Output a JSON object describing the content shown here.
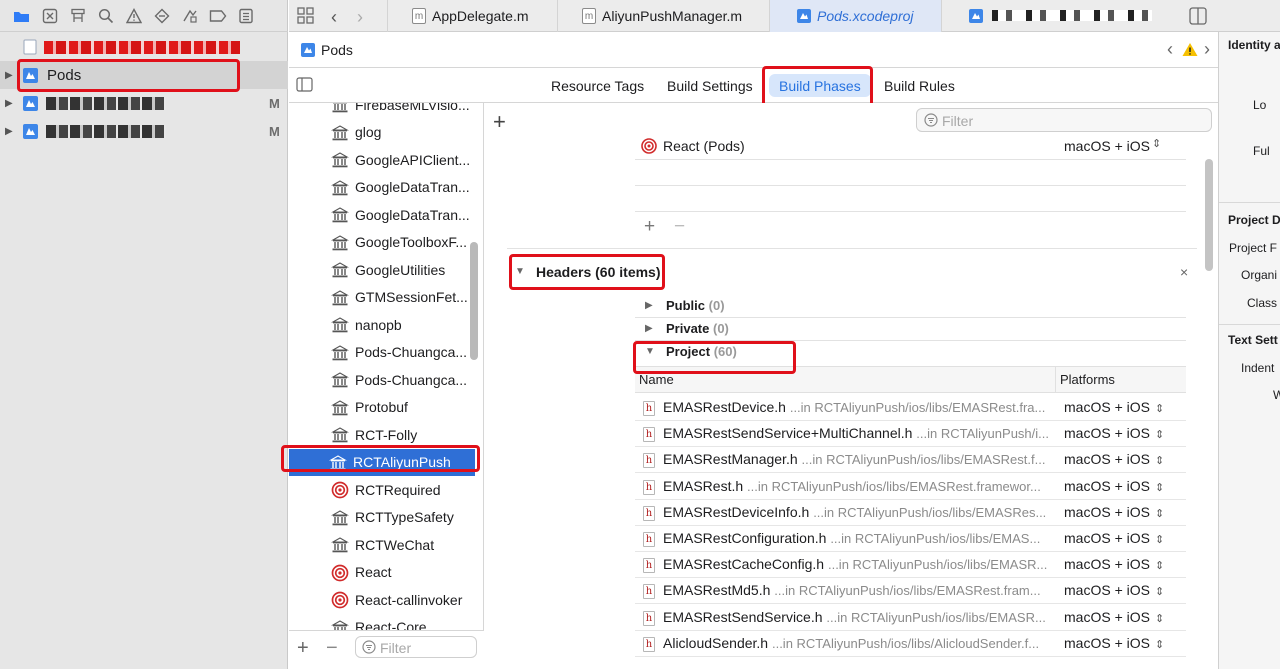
{
  "navigator": {
    "toolbar_icons": [
      "folder-icon",
      "source-control-icon",
      "hierarchy-icon",
      "search-icon",
      "warning-icon",
      "test-diamond-icon",
      "debug-icon",
      "breakpoint-icon",
      "report-icon"
    ],
    "rows": [
      {
        "label": "Pods",
        "mark": ""
      },
      {
        "label": "",
        "mark": "M"
      },
      {
        "label": "",
        "mark": "M"
      }
    ]
  },
  "tabs": [
    {
      "label": "AppDelegate.m"
    },
    {
      "label": "AliyunPushManager.m"
    },
    {
      "label": "Pods.xcodeproj"
    }
  ],
  "pathbar": {
    "project": "Pods"
  },
  "modes": {
    "resource_tags": "Resource Tags",
    "build_settings": "Build Settings",
    "build_phases": "Build Phases",
    "build_rules": "Build Rules"
  },
  "filter": {
    "placeholder": "Filter",
    "bottom_placeholder": "Filter"
  },
  "targets": [
    {
      "label": "FirebaseMLVisio...",
      "kind": "library"
    },
    {
      "label": "glog",
      "kind": "library"
    },
    {
      "label": "GoogleAPIClient...",
      "kind": "library"
    },
    {
      "label": "GoogleDataTran...",
      "kind": "library"
    },
    {
      "label": "GoogleDataTran...",
      "kind": "library"
    },
    {
      "label": "GoogleToolboxF...",
      "kind": "library"
    },
    {
      "label": "GoogleUtilities",
      "kind": "library"
    },
    {
      "label": "GTMSessionFet...",
      "kind": "library"
    },
    {
      "label": "nanopb",
      "kind": "library"
    },
    {
      "label": "Pods-Chuangca...",
      "kind": "library"
    },
    {
      "label": "Pods-Chuangca...",
      "kind": "library"
    },
    {
      "label": "Protobuf",
      "kind": "library"
    },
    {
      "label": "RCT-Folly",
      "kind": "library"
    },
    {
      "label": "RCTAliyunPush",
      "kind": "library",
      "selected": true
    },
    {
      "label": "RCTRequired",
      "kind": "target"
    },
    {
      "label": "RCTTypeSafety",
      "kind": "library"
    },
    {
      "label": "RCTWeChat",
      "kind": "library"
    },
    {
      "label": "React",
      "kind": "target"
    },
    {
      "label": "React-callinvoker",
      "kind": "target"
    },
    {
      "label": "React-Core",
      "kind": "library"
    }
  ],
  "dependency": {
    "name": "React (Pods)",
    "platforms": "macOS + iOS"
  },
  "headers": {
    "title": "Headers (60 items)",
    "public": {
      "label": "Public",
      "count": "(0)"
    },
    "private": {
      "label": "Private",
      "count": "(0)"
    },
    "project": {
      "label": "Project",
      "count": "(60)"
    },
    "col_name": "Name",
    "col_platforms": "Platforms",
    "rows": [
      {
        "name": "EMASRestDevice.h",
        "path": "...in RCTAliyunPush/ios/libs/EMASRest.fra...",
        "platforms": "macOS + iOS"
      },
      {
        "name": "EMASRestSendService+MultiChannel.h",
        "path": "...in RCTAliyunPush/i...",
        "platforms": "macOS + iOS"
      },
      {
        "name": "EMASRestManager.h",
        "path": "...in RCTAliyunPush/ios/libs/EMASRest.f...",
        "platforms": "macOS + iOS"
      },
      {
        "name": "EMASRest.h",
        "path": "...in RCTAliyunPush/ios/libs/EMASRest.framewor...",
        "platforms": "macOS + iOS"
      },
      {
        "name": "EMASRestDeviceInfo.h",
        "path": "...in RCTAliyunPush/ios/libs/EMASRes...",
        "platforms": "macOS + iOS"
      },
      {
        "name": "EMASRestConfiguration.h",
        "path": "...in RCTAliyunPush/ios/libs/EMAS...",
        "platforms": "macOS + iOS"
      },
      {
        "name": "EMASRestCacheConfig.h",
        "path": "...in RCTAliyunPush/ios/libs/EMASR...",
        "platforms": "macOS + iOS"
      },
      {
        "name": "EMASRestMd5.h",
        "path": "...in RCTAliyunPush/ios/libs/EMASRest.fram...",
        "platforms": "macOS + iOS"
      },
      {
        "name": "EMASRestSendService.h",
        "path": "...in RCTAliyunPush/ios/libs/EMASR...",
        "platforms": "macOS + iOS"
      },
      {
        "name": "AlicloudSender.h",
        "path": "...in RCTAliyunPush/ios/libs/AlicloudSender.f...",
        "platforms": "macOS + iOS"
      }
    ]
  },
  "inspector": {
    "identity": "Identity a",
    "lo": "Lo",
    "ful": "Ful",
    "project_doc": "Project D",
    "project_f": "Project F",
    "organi": "Organi",
    "class": "Class",
    "text_settings": "Text Sett",
    "indent": "Indent",
    "w": "W"
  }
}
